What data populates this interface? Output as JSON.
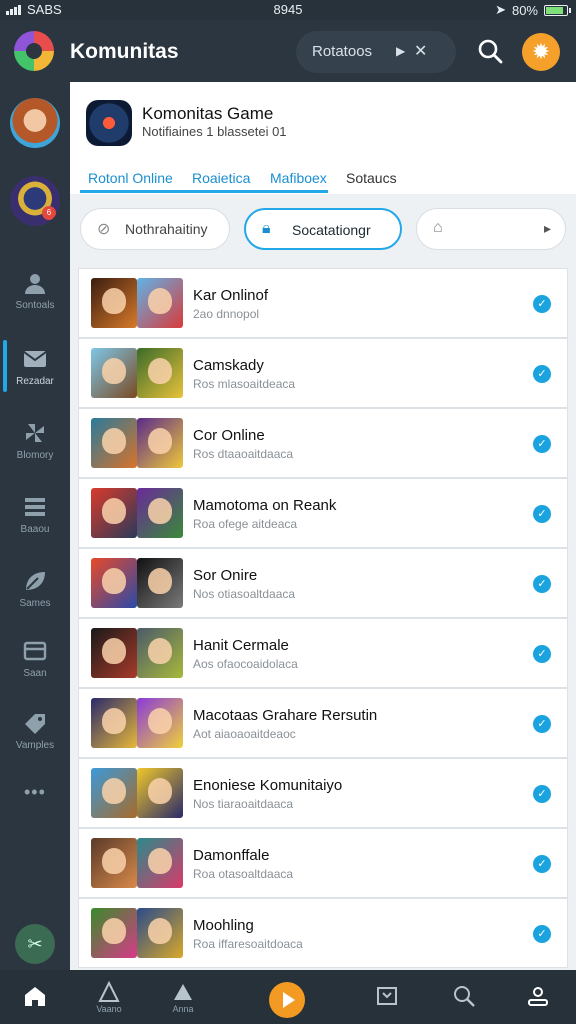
{
  "status_bar": {
    "carrier": "SABS",
    "time": "8945",
    "battery": "80%"
  },
  "header": {
    "app_title": "Komunitas",
    "search_text": "Rotatoos",
    "search_icon": "search-icon",
    "settings_icon": "gear-icon"
  },
  "sidebar": {
    "items": [
      {
        "label": "Sontoals",
        "icon": "people-icon"
      },
      {
        "label": "Rezadar",
        "icon": "mail-icon"
      },
      {
        "label": "Blomory",
        "icon": "pinwheel-icon"
      },
      {
        "label": "Baaou",
        "icon": "list-icon"
      },
      {
        "label": "Sames",
        "icon": "leaf-icon"
      },
      {
        "label": "Saan",
        "icon": "box-icon"
      },
      {
        "label": "Vamples",
        "icon": "tag-icon"
      }
    ],
    "avatar_badge": "6"
  },
  "game": {
    "title": "Komonitas Game",
    "subtitle": "Notifiaines 1 blassetei 01"
  },
  "tabs": [
    {
      "label": "Rotonl Online",
      "highlighted": true
    },
    {
      "label": "Roaietica",
      "highlighted": true
    },
    {
      "label": "Mafiboex",
      "highlighted": true
    },
    {
      "label": "Sotaucs",
      "highlighted": false
    }
  ],
  "filters": [
    {
      "label": "Nothrahaitiny",
      "icon": "compass-icon"
    },
    {
      "label": "Socatationgr",
      "icon": "lock-icon",
      "active": true
    },
    {
      "label": "",
      "icon": "tag-icon"
    }
  ],
  "rows": [
    {
      "title": "Kar Onlinof",
      "subtitle": "2ao dnnopol"
    },
    {
      "title": "Camskady",
      "subtitle": "Ros mlasoaitdeaca"
    },
    {
      "title": "Cor Online",
      "subtitle": "Ros dtaaoaitdaaca"
    },
    {
      "title": "Mamotoma on Reank",
      "subtitle": "Roa ofege aitdeaca"
    },
    {
      "title": "Sor Onire",
      "subtitle": "Nos otiasoaltdaaca"
    },
    {
      "title": "Hanit Cermale",
      "subtitle": "Aos ofaocoaidolaca"
    },
    {
      "title": "Macotaas Grahare Rersutin",
      "subtitle": "Aot aiaoaoaitdeaoc"
    },
    {
      "title": "Enoniese Komunitaiyo",
      "subtitle": "Nos tiaraoaitdaaca"
    },
    {
      "title": "Damonffale",
      "subtitle": "Roa otasoaltdaaca"
    },
    {
      "title": "Moohling",
      "subtitle": "Roa iffaresoaitdoaca"
    }
  ],
  "bottom_nav": [
    {
      "label": "",
      "icon": "home-icon"
    },
    {
      "label": "Vaano",
      "icon": "triangle-icon"
    },
    {
      "label": "Anna",
      "icon": "stack-icon"
    },
    {
      "label": "",
      "icon": "play-icon"
    },
    {
      "label": "",
      "icon": "inbox-icon"
    },
    {
      "label": "",
      "icon": "search-icon"
    },
    {
      "label": "",
      "icon": "profile-icon"
    }
  ],
  "colors": {
    "accent": "#22a7e8",
    "orange": "#f39a22",
    "dark": "#2b3640"
  }
}
